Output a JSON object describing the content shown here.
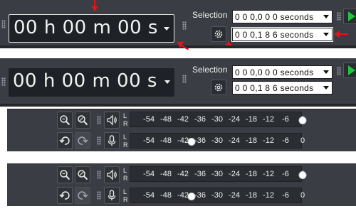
{
  "toolbar_top": {
    "time_display": "00 h 00 m 00 s",
    "selection_label": "Selection",
    "selection_start": "0 0 0,0 0 0 seconds",
    "selection_end": "0 0 0,1 8 6 seconds"
  },
  "toolbar_bottom": {
    "time_display": "00 h 00 m 00 s",
    "selection_label": "Selection",
    "selection_start": "0 0 0,0 0 0 seconds",
    "selection_end": "0 0 0,1 8 6 seconds"
  },
  "meters": {
    "channel_top": "L",
    "channel_bottom": "R",
    "ticks": [
      "-54",
      "-48",
      "-42",
      "-36",
      "-30",
      "-24",
      "-18",
      "-12",
      "-6",
      "0"
    ],
    "playback_slider_level_db": 0,
    "recording_slider_level_db": -39
  },
  "colors": {
    "toolbar_bg": "#3a3d43",
    "annotation_red": "#e3141b",
    "play_green": "#21c43d"
  },
  "icons": [
    "grip-icon",
    "dropdown-caret-icon",
    "gear-icon",
    "play-icon",
    "zoom-in-icon",
    "zoom-out-icon",
    "undo-icon",
    "redo-icon",
    "speaker-icon",
    "microphone-icon"
  ]
}
